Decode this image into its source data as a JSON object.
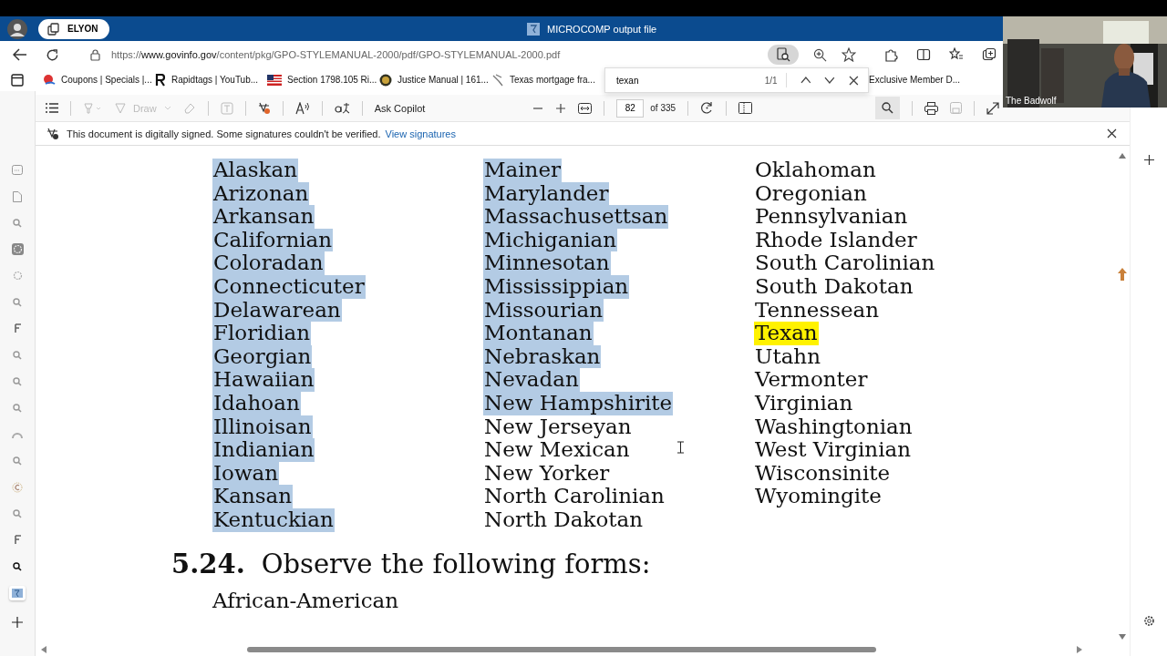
{
  "titlebar": {
    "profile": "ELYON",
    "title": "MICROCOMP output file"
  },
  "address": {
    "url_prefix": "https://",
    "url_host": "www.govinfo.gov",
    "url_path": "/content/pkg/GPO-STYLEMANUAL-2000/pdf/GPO-STYLEMANUAL-2000.pdf"
  },
  "bookmarks": [
    {
      "label": "Coupons | Specials |...",
      "kind": "coupon"
    },
    {
      "label": "Rapidtags | YouTub...",
      "kind": "letter-r"
    },
    {
      "label": "Section 1798.105 Ri...",
      "kind": "flag"
    },
    {
      "label": "Justice Manual | 161...",
      "kind": "seal"
    },
    {
      "label": "Texas mortgage fra...",
      "kind": "pin"
    },
    {
      "label": "Exclusive Member D...",
      "kind": "none"
    }
  ],
  "find": {
    "value": "texan",
    "count": "1/1"
  },
  "pdf_toolbar": {
    "draw": "Draw",
    "copilot": "Ask Copilot",
    "page": "82",
    "of": "of 335"
  },
  "signature_bar": {
    "message": "This document is digitally signed. Some signatures couldn't be verified.",
    "link": "View signatures"
  },
  "webcam": {
    "name": "The Badwolf"
  },
  "document": {
    "columns": [
      [
        {
          "text": "Alaskan",
          "selected": true,
          "match": false
        },
        {
          "text": "Arizonan",
          "selected": true,
          "match": false
        },
        {
          "text": "Arkansan",
          "selected": true,
          "match": false
        },
        {
          "text": "Californian",
          "selected": true,
          "match": false
        },
        {
          "text": "Coloradan",
          "selected": true,
          "match": false
        },
        {
          "text": "Connecticuter",
          "selected": true,
          "match": false
        },
        {
          "text": "Delawarean",
          "selected": true,
          "match": false
        },
        {
          "text": "Floridian",
          "selected": true,
          "match": false
        },
        {
          "text": "Georgian",
          "selected": true,
          "match": false
        },
        {
          "text": "Hawaiian",
          "selected": true,
          "match": false
        },
        {
          "text": "Idahoan",
          "selected": true,
          "match": false
        },
        {
          "text": "Illinoisan",
          "selected": true,
          "match": false
        },
        {
          "text": "Indianian",
          "selected": true,
          "match": false
        },
        {
          "text": "Iowan",
          "selected": true,
          "match": false
        },
        {
          "text": "Kansan",
          "selected": true,
          "match": false
        },
        {
          "text": "Kentuckian",
          "selected": true,
          "match": false
        }
      ],
      [
        {
          "text": "Mainer",
          "selected": true,
          "match": false
        },
        {
          "text": "Marylander",
          "selected": true,
          "match": false
        },
        {
          "text": "Massachusettsan",
          "selected": true,
          "match": false
        },
        {
          "text": "Michiganian",
          "selected": true,
          "match": false
        },
        {
          "text": "Minnesotan",
          "selected": true,
          "match": false
        },
        {
          "text": "Mississippian",
          "selected": true,
          "match": false
        },
        {
          "text": "Missourian",
          "selected": true,
          "match": false
        },
        {
          "text": "Montanan",
          "selected": true,
          "match": false
        },
        {
          "text": "Nebraskan",
          "selected": true,
          "match": false
        },
        {
          "text": "Nevadan",
          "selected": true,
          "match": false
        },
        {
          "text": "New Hampshirite",
          "selected": true,
          "match": false
        },
        {
          "text": "New Jerseyan",
          "selected": false,
          "match": false
        },
        {
          "text": "New Mexican",
          "selected": false,
          "match": false
        },
        {
          "text": "New Yorker",
          "selected": false,
          "match": false
        },
        {
          "text": "North Carolinian",
          "selected": false,
          "match": false
        },
        {
          "text": "North Dakotan",
          "selected": false,
          "match": false
        }
      ],
      [
        {
          "text": "Oklahoman",
          "selected": false,
          "match": false
        },
        {
          "text": "Oregonian",
          "selected": false,
          "match": false
        },
        {
          "text": "Pennsylvanian",
          "selected": false,
          "match": false
        },
        {
          "text": "Rhode Islander",
          "selected": false,
          "match": false
        },
        {
          "text": "South Carolinian",
          "selected": false,
          "match": false
        },
        {
          "text": "South Dakotan",
          "selected": false,
          "match": false
        },
        {
          "text": "Tennessean",
          "selected": false,
          "match": false
        },
        {
          "text": "Texan",
          "selected": false,
          "match": true
        },
        {
          "text": "Utahn",
          "selected": false,
          "match": false
        },
        {
          "text": "Vermonter",
          "selected": false,
          "match": false
        },
        {
          "text": "Virginian",
          "selected": false,
          "match": false
        },
        {
          "text": "Washingtonian",
          "selected": false,
          "match": false
        },
        {
          "text": "West Virginian",
          "selected": false,
          "match": false
        },
        {
          "text": "Wisconsinite",
          "selected": false,
          "match": false
        },
        {
          "text": "Wyomingite",
          "selected": false,
          "match": false
        }
      ]
    ],
    "section_number": "5.24.",
    "section_title": "Observe the following forms:",
    "first_form": "African-American"
  }
}
